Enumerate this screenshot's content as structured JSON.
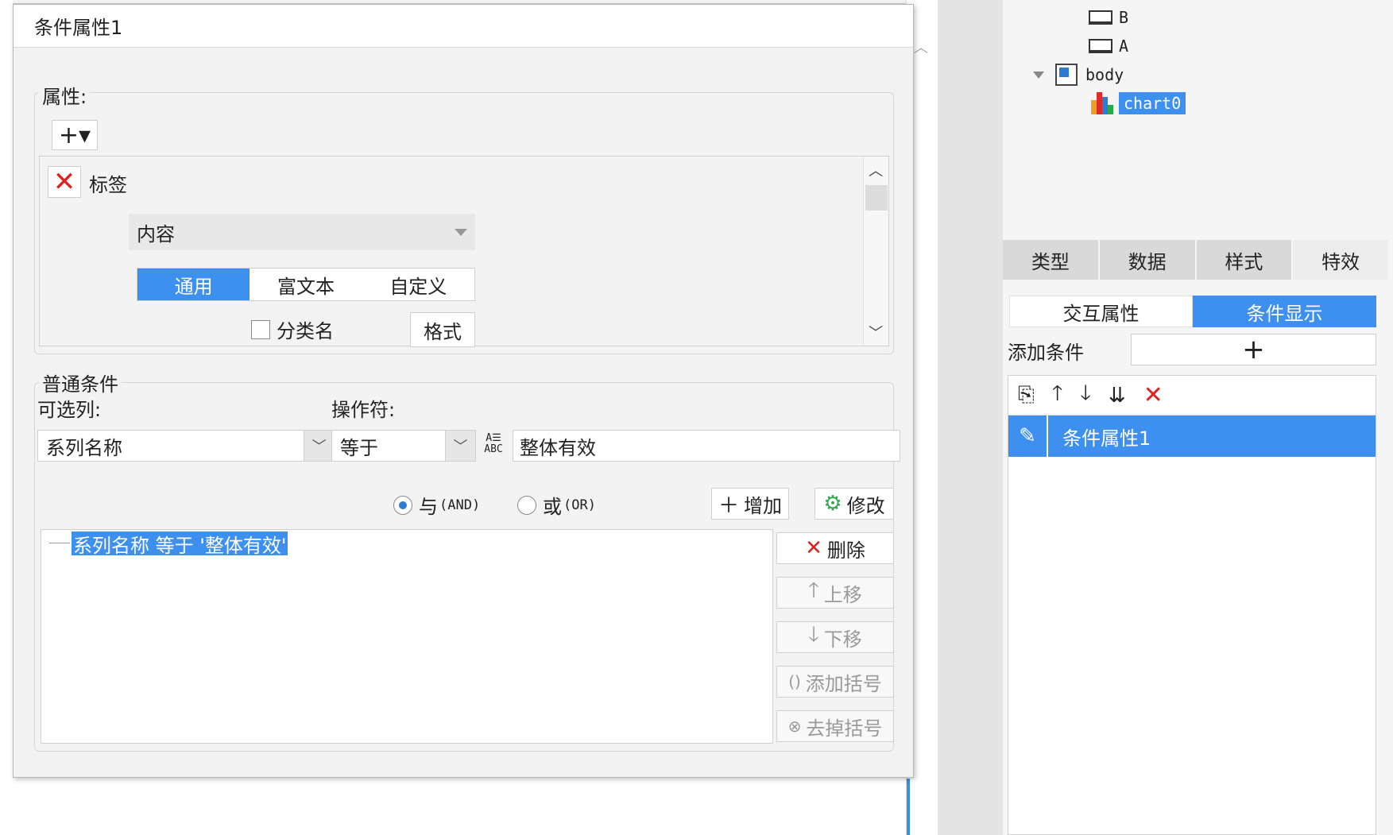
{
  "dialog": {
    "title": "条件属性1",
    "properties_group": {
      "label": "属性:",
      "add_button_label": "+▾",
      "tag_label": "标签",
      "content_select_value": "内容",
      "format_tabs": [
        "通用",
        "富文本",
        "自定义"
      ],
      "category_checkbox_label": "分类名",
      "format_button_label": "格式"
    },
    "condition_group": {
      "label": "普通条件",
      "column_label": "可选列:",
      "column_value": "系列名称",
      "operator_label": "操作符:",
      "operator_value": "等于",
      "value_text": "整体有效",
      "abc_icon_top": "A☰",
      "abc_icon_bottom": "ABC",
      "radio_and_label": "与",
      "radio_and_sub": "(AND)",
      "radio_or_label": "或",
      "radio_or_sub": "(OR)",
      "add_button_label": "增加",
      "modify_button_label": "修改",
      "delete_button_label": "删除",
      "move_up_label": "上移",
      "move_down_label": "下移",
      "add_bracket_label": "添加括号",
      "remove_bracket_label": "去掉括号",
      "condition_item": "系列名称 等于 '整体有效'"
    }
  },
  "right_panel": {
    "tree": {
      "item_b": "B",
      "item_a": "A",
      "item_body": "body",
      "item_chart": "chart0"
    },
    "tabs": [
      "类型",
      "数据",
      "样式",
      "特效"
    ],
    "subtabs": [
      "交互属性",
      "条件显示"
    ],
    "add_condition_label": "添加条件",
    "add_condition_button": "+",
    "condition_item": "条件属性1"
  },
  "colors": {
    "accent": "#3d8ff0",
    "delete_red": "#e02020"
  }
}
